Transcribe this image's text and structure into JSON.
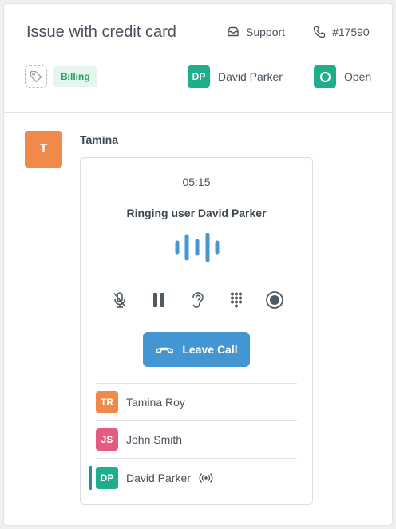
{
  "ticket": {
    "title": "Issue with credit card",
    "channel": "Support",
    "number": "#17590",
    "tag_label": "Billing",
    "assignee": {
      "initials": "DP",
      "name": "David Parker"
    },
    "status": "Open"
  },
  "message": {
    "sender_initial": "T",
    "sender_name": "Tamina"
  },
  "call": {
    "timer": "05:15",
    "status_text": "Ringing user David Parker",
    "leave_label": "Leave Call",
    "controls": [
      "mic-off-icon",
      "pause-icon",
      "listen-icon",
      "keypad-icon",
      "record-icon"
    ],
    "participants": [
      {
        "initials": "TR",
        "name": "Tamina Roy",
        "color": "#f0894a"
      },
      {
        "initials": "JS",
        "name": "John Smith",
        "color": "#e35b7f"
      },
      {
        "initials": "DP",
        "name": "David Parker",
        "color": "#1fae8c",
        "active": true
      }
    ]
  },
  "colors": {
    "primary": "#4396d1",
    "green": "#1fae8c",
    "orange": "#f0894a",
    "pink": "#e35b7f",
    "billing_bg": "#e3f5ec",
    "billing_text": "#2aa061"
  }
}
